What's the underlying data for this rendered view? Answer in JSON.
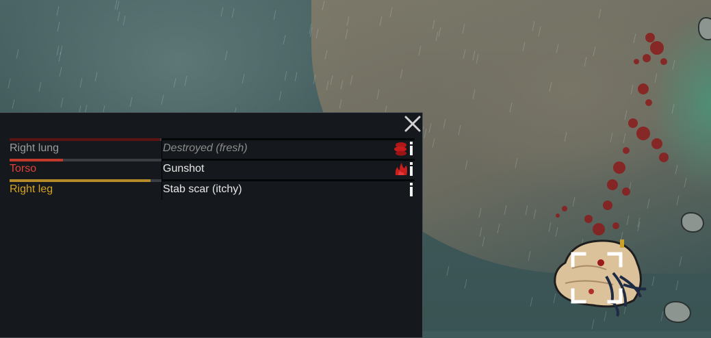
{
  "health_panel": {
    "close_icon": "close-x-icon",
    "rows": [
      {
        "part": "Right lung",
        "part_color": "#9c9c9c",
        "health_fraction": 0.99,
        "bar_color": "#5a1414",
        "hediff": "Destroyed (fresh)",
        "hediff_italic": true,
        "hediff_icon": "bleeding-icon",
        "info_icon": "info-icon"
      },
      {
        "part": "Torso",
        "part_color": "#e0413a",
        "health_fraction": 0.35,
        "bar_color": "#c0392b",
        "hediff": "Gunshot",
        "hediff_italic": false,
        "hediff_icon": "fresh-wound-icon",
        "info_icon": "info-icon"
      },
      {
        "part": "Right leg",
        "part_color": "#d8a520",
        "health_fraction": 0.93,
        "bar_color": "#b58b2a",
        "hediff": "Stab scar (itchy)",
        "hediff_italic": false,
        "hediff_icon": "",
        "info_icon": "info-icon"
      }
    ]
  }
}
